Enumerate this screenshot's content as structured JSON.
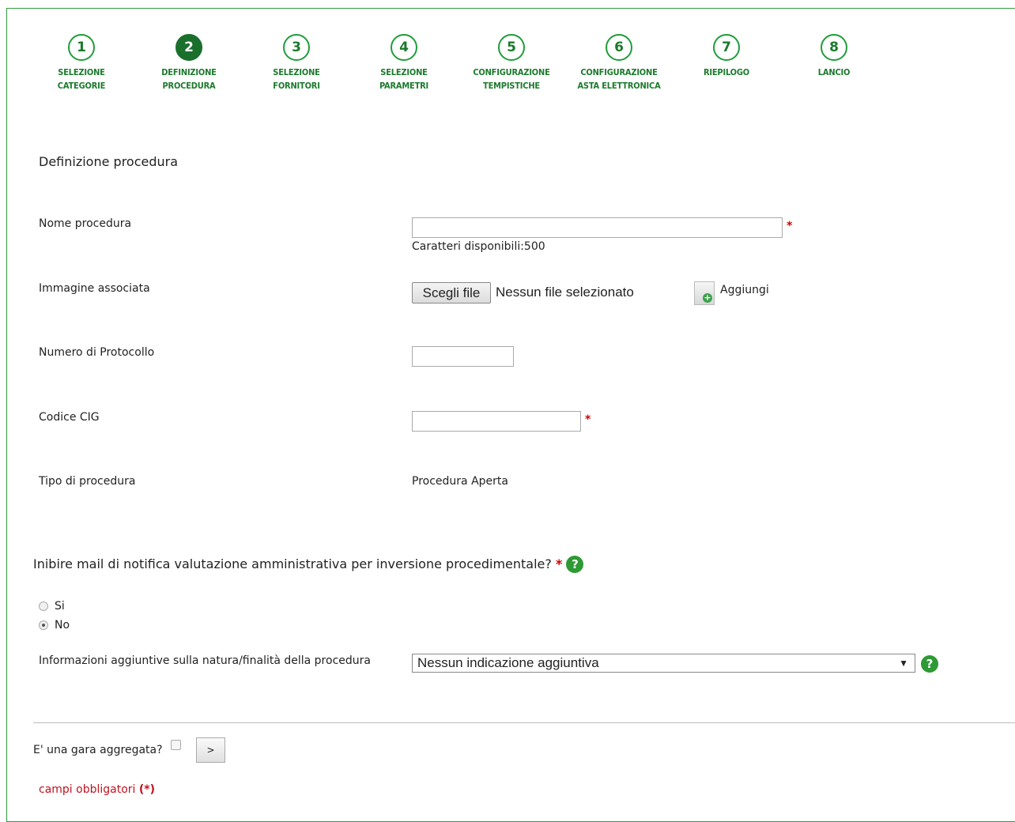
{
  "steps": [
    {
      "number": "1",
      "line1": "SELEZIONE",
      "line2": "CATEGORIE",
      "active": false
    },
    {
      "number": "2",
      "line1": "DEFINIZIONE",
      "line2": "PROCEDURA",
      "active": true
    },
    {
      "number": "3",
      "line1": "SELEZIONE",
      "line2": "FORNITORI",
      "active": false
    },
    {
      "number": "4",
      "line1": "SELEZIONE",
      "line2": "PARAMETRI",
      "active": false
    },
    {
      "number": "5",
      "line1": "CONFIGURAZIONE",
      "line2": "TEMPISTICHE",
      "active": false
    },
    {
      "number": "6",
      "line1": "CONFIGURAZIONE",
      "line2": "ASTA ELETTRONICA",
      "active": false
    },
    {
      "number": "7",
      "line1": "RIEPILOGO",
      "line2": "",
      "active": false
    },
    {
      "number": "8",
      "line1": "LANCIO",
      "line2": "",
      "active": false
    }
  ],
  "section_title": "Definizione procedura",
  "fields": {
    "nome_procedura": {
      "label": "Nome procedura",
      "value": "",
      "required_mark": "*",
      "hint": "Caratteri disponibili:500"
    },
    "immagine": {
      "label": "Immagine associata",
      "button": "Scegli file",
      "status": "Nessun file selezionato",
      "add_label": "Aggiungi"
    },
    "protocollo": {
      "label": "Numero di Protocollo",
      "value": ""
    },
    "cig": {
      "label": "Codice CIG",
      "value": "",
      "required_mark": "*"
    },
    "tipo": {
      "label": "Tipo di procedura",
      "value": "Procedura Aperta"
    }
  },
  "question": {
    "text": "Inibire mail di notifica valutazione amministrativa per inversione procedimentale?",
    "required_mark": "*",
    "help": "?",
    "options": [
      {
        "label": "Si",
        "checked": false
      },
      {
        "label": "No",
        "checked": true
      }
    ]
  },
  "info": {
    "label": "Informazioni aggiuntive sulla natura/finalità della procedura",
    "selected": "Nessun indicazione aggiuntiva",
    "arrow": "▼",
    "help": "?"
  },
  "aggregata": {
    "label": "E' una gara aggregata?",
    "checked": false,
    "button": ">"
  },
  "footer": {
    "text": "campi obbligatori ",
    "star": "(*)"
  }
}
